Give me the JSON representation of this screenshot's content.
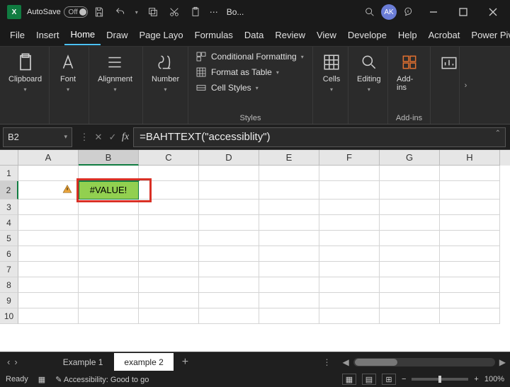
{
  "titlebar": {
    "app_icon_text": "X",
    "autosave_label": "AutoSave",
    "autosave_state": "Off",
    "filename": "Bo...",
    "avatar": "AK"
  },
  "menu": {
    "items": [
      "File",
      "Insert",
      "Home",
      "Draw",
      "Page Layo",
      "Formulas",
      "Data",
      "Review",
      "View",
      "Develope",
      "Help",
      "Acrobat",
      "Power Piv"
    ],
    "active_index": 2
  },
  "ribbon": {
    "clipboard": "Clipboard",
    "font": "Font",
    "alignment": "Alignment",
    "number": "Number",
    "cond_format": "Conditional Formatting",
    "format_table": "Format as Table",
    "cell_styles": "Cell Styles",
    "styles_label": "Styles",
    "cells": "Cells",
    "editing": "Editing",
    "addins": "Add-ins",
    "addins_label": "Add-ins"
  },
  "formula": {
    "name_box": "B2",
    "content": "=BAHTTEXT(\"accessiblity\")"
  },
  "grid": {
    "columns": [
      "A",
      "B",
      "C",
      "D",
      "E",
      "F",
      "G",
      "H"
    ],
    "selected_col": "B",
    "selected_row": 2,
    "row_count": 10,
    "b2_value": "#VALUE!"
  },
  "sheets": {
    "tabs": [
      "Example 1",
      "example 2"
    ],
    "active_index": 1
  },
  "status": {
    "ready": "Ready",
    "accessibility": "Accessibility: Good to go",
    "zoom": "100%"
  }
}
